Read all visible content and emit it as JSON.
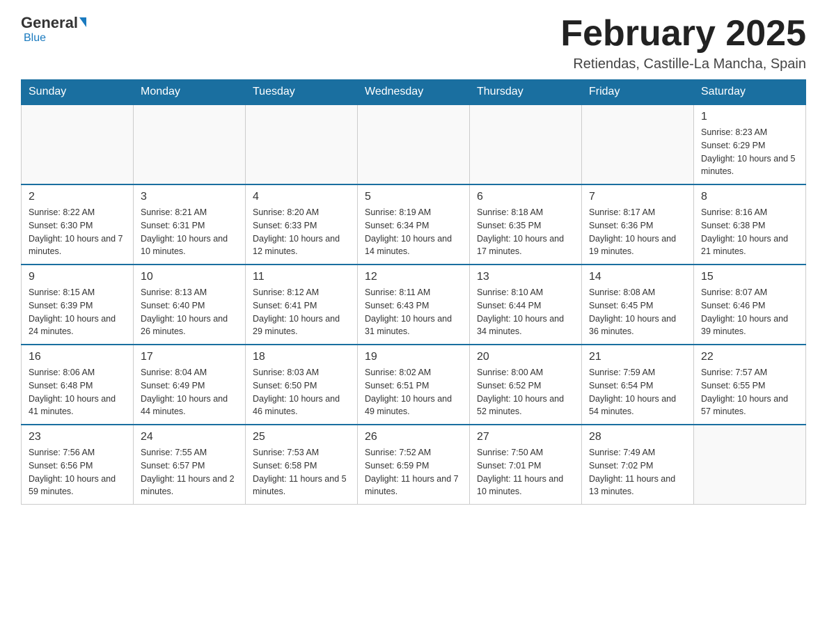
{
  "logo": {
    "general": "General",
    "blue": "Blue"
  },
  "title": "February 2025",
  "location": "Retiendas, Castille-La Mancha, Spain",
  "weekdays": [
    "Sunday",
    "Monday",
    "Tuesday",
    "Wednesday",
    "Thursday",
    "Friday",
    "Saturday"
  ],
  "weeks": [
    [
      {
        "day": "",
        "info": ""
      },
      {
        "day": "",
        "info": ""
      },
      {
        "day": "",
        "info": ""
      },
      {
        "day": "",
        "info": ""
      },
      {
        "day": "",
        "info": ""
      },
      {
        "day": "",
        "info": ""
      },
      {
        "day": "1",
        "info": "Sunrise: 8:23 AM\nSunset: 6:29 PM\nDaylight: 10 hours and 5 minutes."
      }
    ],
    [
      {
        "day": "2",
        "info": "Sunrise: 8:22 AM\nSunset: 6:30 PM\nDaylight: 10 hours and 7 minutes."
      },
      {
        "day": "3",
        "info": "Sunrise: 8:21 AM\nSunset: 6:31 PM\nDaylight: 10 hours and 10 minutes."
      },
      {
        "day": "4",
        "info": "Sunrise: 8:20 AM\nSunset: 6:33 PM\nDaylight: 10 hours and 12 minutes."
      },
      {
        "day": "5",
        "info": "Sunrise: 8:19 AM\nSunset: 6:34 PM\nDaylight: 10 hours and 14 minutes."
      },
      {
        "day": "6",
        "info": "Sunrise: 8:18 AM\nSunset: 6:35 PM\nDaylight: 10 hours and 17 minutes."
      },
      {
        "day": "7",
        "info": "Sunrise: 8:17 AM\nSunset: 6:36 PM\nDaylight: 10 hours and 19 minutes."
      },
      {
        "day": "8",
        "info": "Sunrise: 8:16 AM\nSunset: 6:38 PM\nDaylight: 10 hours and 21 minutes."
      }
    ],
    [
      {
        "day": "9",
        "info": "Sunrise: 8:15 AM\nSunset: 6:39 PM\nDaylight: 10 hours and 24 minutes."
      },
      {
        "day": "10",
        "info": "Sunrise: 8:13 AM\nSunset: 6:40 PM\nDaylight: 10 hours and 26 minutes."
      },
      {
        "day": "11",
        "info": "Sunrise: 8:12 AM\nSunset: 6:41 PM\nDaylight: 10 hours and 29 minutes."
      },
      {
        "day": "12",
        "info": "Sunrise: 8:11 AM\nSunset: 6:43 PM\nDaylight: 10 hours and 31 minutes."
      },
      {
        "day": "13",
        "info": "Sunrise: 8:10 AM\nSunset: 6:44 PM\nDaylight: 10 hours and 34 minutes."
      },
      {
        "day": "14",
        "info": "Sunrise: 8:08 AM\nSunset: 6:45 PM\nDaylight: 10 hours and 36 minutes."
      },
      {
        "day": "15",
        "info": "Sunrise: 8:07 AM\nSunset: 6:46 PM\nDaylight: 10 hours and 39 minutes."
      }
    ],
    [
      {
        "day": "16",
        "info": "Sunrise: 8:06 AM\nSunset: 6:48 PM\nDaylight: 10 hours and 41 minutes."
      },
      {
        "day": "17",
        "info": "Sunrise: 8:04 AM\nSunset: 6:49 PM\nDaylight: 10 hours and 44 minutes."
      },
      {
        "day": "18",
        "info": "Sunrise: 8:03 AM\nSunset: 6:50 PM\nDaylight: 10 hours and 46 minutes."
      },
      {
        "day": "19",
        "info": "Sunrise: 8:02 AM\nSunset: 6:51 PM\nDaylight: 10 hours and 49 minutes."
      },
      {
        "day": "20",
        "info": "Sunrise: 8:00 AM\nSunset: 6:52 PM\nDaylight: 10 hours and 52 minutes."
      },
      {
        "day": "21",
        "info": "Sunrise: 7:59 AM\nSunset: 6:54 PM\nDaylight: 10 hours and 54 minutes."
      },
      {
        "day": "22",
        "info": "Sunrise: 7:57 AM\nSunset: 6:55 PM\nDaylight: 10 hours and 57 minutes."
      }
    ],
    [
      {
        "day": "23",
        "info": "Sunrise: 7:56 AM\nSunset: 6:56 PM\nDaylight: 10 hours and 59 minutes."
      },
      {
        "day": "24",
        "info": "Sunrise: 7:55 AM\nSunset: 6:57 PM\nDaylight: 11 hours and 2 minutes."
      },
      {
        "day": "25",
        "info": "Sunrise: 7:53 AM\nSunset: 6:58 PM\nDaylight: 11 hours and 5 minutes."
      },
      {
        "day": "26",
        "info": "Sunrise: 7:52 AM\nSunset: 6:59 PM\nDaylight: 11 hours and 7 minutes."
      },
      {
        "day": "27",
        "info": "Sunrise: 7:50 AM\nSunset: 7:01 PM\nDaylight: 11 hours and 10 minutes."
      },
      {
        "day": "28",
        "info": "Sunrise: 7:49 AM\nSunset: 7:02 PM\nDaylight: 11 hours and 13 minutes."
      },
      {
        "day": "",
        "info": ""
      }
    ]
  ]
}
